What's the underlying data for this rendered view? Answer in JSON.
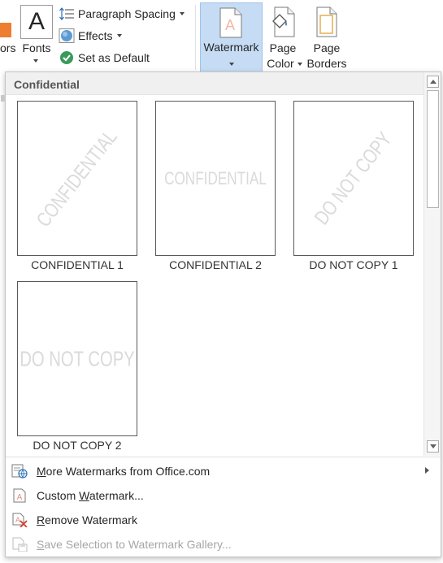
{
  "ribbon": {
    "colors_label": "ors",
    "fonts_label": "Fonts",
    "fonts_glyph": "A",
    "paragraph_spacing": "Paragraph Spacing",
    "effects": "Effects",
    "set_as_default": "Set as Default",
    "watermark": "Watermark",
    "page_color_line1": "Page",
    "page_color_line2": "Color",
    "page_borders_line1": "Page",
    "page_borders_line2": "Borders"
  },
  "gallery": {
    "section_title": "Confidential",
    "items": [
      {
        "name": "CONFIDENTIAL 1",
        "watermark_text": "CONFIDENTIAL",
        "style": "diagonal"
      },
      {
        "name": "CONFIDENTIAL 2",
        "watermark_text": "CONFIDENTIAL",
        "style": "horizontal"
      },
      {
        "name": "DO NOT COPY 1",
        "watermark_text": "DO NOT COPY",
        "style": "diagonal"
      },
      {
        "name": "DO NOT COPY 2",
        "watermark_text": "DO NOT COPY",
        "style": "horizontal"
      }
    ]
  },
  "menu": {
    "more_watermarks": {
      "mnemonic": "M",
      "rest": "ore Watermarks from Office.com"
    },
    "custom_watermark": {
      "before": "Custom ",
      "mnemonic": "W",
      "rest": "atermark..."
    },
    "remove_watermark": {
      "mnemonic": "R",
      "rest": "emove Watermark"
    },
    "save_selection": {
      "mnemonic": "S",
      "rest": "ave Selection to Watermark Gallery..."
    }
  },
  "colors": {
    "accent_orange": "#ed7d31",
    "selected_button": "#c5dcf4",
    "watermark_text": "#dadada"
  }
}
